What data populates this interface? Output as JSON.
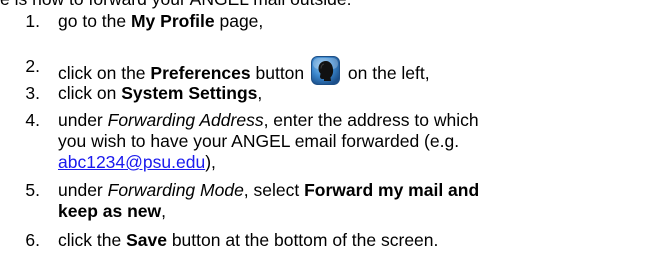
{
  "intro": "e is how to forward your ANGEL mail outside:",
  "steps": [
    {
      "num": "1.",
      "before": "go to the ",
      "bold": "My Profile",
      "after": " page,"
    },
    {
      "num": "2.",
      "before": "click on the ",
      "bold": "Preferences",
      "after_bold": " button",
      "after": " on the left,"
    },
    {
      "num": "3.",
      "before": "click on ",
      "bold": "System Settings",
      "after": ","
    },
    {
      "num": "4.",
      "before": "under ",
      "italic": "Forwarding Address",
      "line1": ", enter the address to which",
      "line2": "you wish to have your ANGEL email forwarded (e.g.",
      "link": "abc1234@psu.edu",
      "after_link": "),"
    },
    {
      "num": "5.",
      "before": "under ",
      "italic": "Forwarding Mode",
      "middle": ", select ",
      "bold_line1": "Forward my mail and",
      "bold_line2": "keep as new",
      "after": ","
    },
    {
      "num": "6.",
      "before": "click the ",
      "bold": "Save",
      "after": " button at the bottom of the screen."
    }
  ],
  "icons": {
    "preferences": "profile-head-icon"
  },
  "colors": {
    "link": "#1a1aee",
    "icon_blue": "#2f6fb3"
  }
}
